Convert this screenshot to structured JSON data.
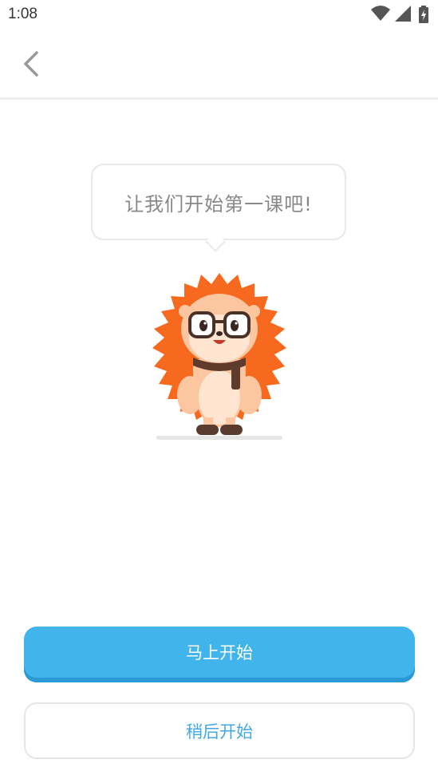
{
  "status_bar": {
    "time": "1:08",
    "icons": [
      "wifi-icon",
      "cellular-signal-icon",
      "battery-charging-icon"
    ]
  },
  "nav": {
    "back_icon": "chevron-left-icon"
  },
  "bubble": {
    "text": "让我们开始第一课吧!"
  },
  "mascot": {
    "icon": "hedgehog-mascot"
  },
  "actions": {
    "start_now": "马上开始",
    "start_later": "稍后开始"
  },
  "colors": {
    "primary": "#41b4ec",
    "primary_shadow": "#2a9ad4",
    "secondary_text": "#41a9e0",
    "mascot_orange": "#f7691e"
  }
}
